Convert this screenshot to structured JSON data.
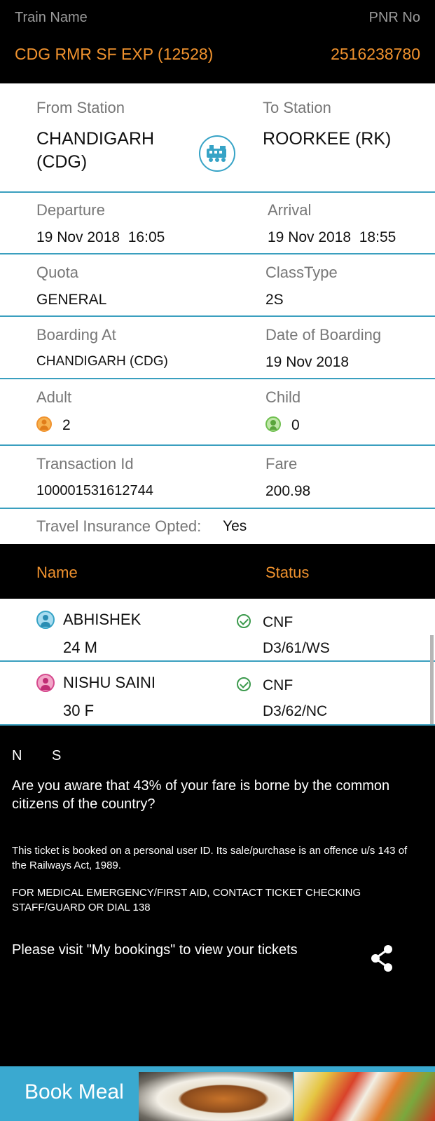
{
  "header": {
    "train_name_label": "Train Name",
    "pnr_label": "PNR No",
    "train_name": "CDG RMR SF EXP (12528)",
    "pnr": "2516238780"
  },
  "journey": {
    "from_label": "From Station",
    "to_label": "To Station",
    "from_station_line1": "CHANDIGARH",
    "from_station_line2": "(CDG)",
    "to_station": "ROORKEE (RK)",
    "train_icon": "train-icon"
  },
  "timing": {
    "departure_label": "Departure",
    "arrival_label": "Arrival",
    "departure": "19 Nov 2018  16:05",
    "arrival": "19 Nov 2018  18:55"
  },
  "quota": {
    "quota_label": "Quota",
    "class_label": "ClassType",
    "quota": "GENERAL",
    "class": "2S"
  },
  "boarding": {
    "boarding_label": "Boarding At",
    "date_label": "Date of Boarding",
    "boarding_at": "CHANDIGARH (CDG)",
    "date": "19 Nov 2018"
  },
  "counts": {
    "adult_label": "Adult",
    "child_label": "Child",
    "adult": "2",
    "child": "0"
  },
  "payment": {
    "transaction_label": "Transaction Id",
    "fare_label": "Fare",
    "transaction_id": "100001531612744",
    "fare": "200.98"
  },
  "insurance": {
    "label": "Travel Insurance Opted:",
    "value": "Yes"
  },
  "passengers": {
    "name_header": "Name",
    "status_header": "Status",
    "list": [
      {
        "name": "ABHISHEK",
        "age_gender": "24 M",
        "status": "CNF",
        "berth": "D3/61/WS"
      },
      {
        "name": "NISHU SAINI",
        "age_gender": "30 F",
        "status": "CNF",
        "berth": "D3/62/NC"
      }
    ]
  },
  "footer": {
    "n": "N",
    "s": "S",
    "aware": "Are you aware that 43% of your fare is borne by the common citizens of the country?",
    "personal_id": "This ticket is booked on a personal user ID. Its sale/purchase is an offence u/s 143 of the Railways Act, 1989.",
    "medical": "FOR MEDICAL EMERGENCY/FIRST AID, CONTACT TICKET CHECKING STAFF/GUARD OR DIAL 138",
    "visit": "Please visit \"My bookings\" to view your tickets"
  },
  "book_meal": {
    "label": "Book Meal"
  },
  "colors": {
    "accent_orange": "#f0922e",
    "divider_blue": "#3a9fbf",
    "banner_blue": "#3aa9d0",
    "status_green": "#3c9a4d"
  }
}
